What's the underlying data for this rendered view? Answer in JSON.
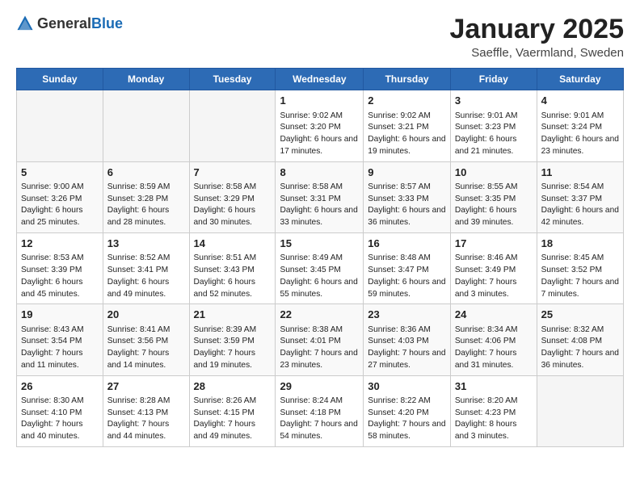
{
  "header": {
    "logo_general": "General",
    "logo_blue": "Blue",
    "title": "January 2025",
    "subtitle": "Saeffle, Vaermland, Sweden"
  },
  "weekdays": [
    "Sunday",
    "Monday",
    "Tuesday",
    "Wednesday",
    "Thursday",
    "Friday",
    "Saturday"
  ],
  "weeks": [
    [
      {
        "day": "",
        "info": ""
      },
      {
        "day": "",
        "info": ""
      },
      {
        "day": "",
        "info": ""
      },
      {
        "day": "1",
        "info": "Sunrise: 9:02 AM\nSunset: 3:20 PM\nDaylight: 6 hours\nand 17 minutes."
      },
      {
        "day": "2",
        "info": "Sunrise: 9:02 AM\nSunset: 3:21 PM\nDaylight: 6 hours\nand 19 minutes."
      },
      {
        "day": "3",
        "info": "Sunrise: 9:01 AM\nSunset: 3:23 PM\nDaylight: 6 hours\nand 21 minutes."
      },
      {
        "day": "4",
        "info": "Sunrise: 9:01 AM\nSunset: 3:24 PM\nDaylight: 6 hours\nand 23 minutes."
      }
    ],
    [
      {
        "day": "5",
        "info": "Sunrise: 9:00 AM\nSunset: 3:26 PM\nDaylight: 6 hours\nand 25 minutes."
      },
      {
        "day": "6",
        "info": "Sunrise: 8:59 AM\nSunset: 3:28 PM\nDaylight: 6 hours\nand 28 minutes."
      },
      {
        "day": "7",
        "info": "Sunrise: 8:58 AM\nSunset: 3:29 PM\nDaylight: 6 hours\nand 30 minutes."
      },
      {
        "day": "8",
        "info": "Sunrise: 8:58 AM\nSunset: 3:31 PM\nDaylight: 6 hours\nand 33 minutes."
      },
      {
        "day": "9",
        "info": "Sunrise: 8:57 AM\nSunset: 3:33 PM\nDaylight: 6 hours\nand 36 minutes."
      },
      {
        "day": "10",
        "info": "Sunrise: 8:55 AM\nSunset: 3:35 PM\nDaylight: 6 hours\nand 39 minutes."
      },
      {
        "day": "11",
        "info": "Sunrise: 8:54 AM\nSunset: 3:37 PM\nDaylight: 6 hours\nand 42 minutes."
      }
    ],
    [
      {
        "day": "12",
        "info": "Sunrise: 8:53 AM\nSunset: 3:39 PM\nDaylight: 6 hours\nand 45 minutes."
      },
      {
        "day": "13",
        "info": "Sunrise: 8:52 AM\nSunset: 3:41 PM\nDaylight: 6 hours\nand 49 minutes."
      },
      {
        "day": "14",
        "info": "Sunrise: 8:51 AM\nSunset: 3:43 PM\nDaylight: 6 hours\nand 52 minutes."
      },
      {
        "day": "15",
        "info": "Sunrise: 8:49 AM\nSunset: 3:45 PM\nDaylight: 6 hours\nand 55 minutes."
      },
      {
        "day": "16",
        "info": "Sunrise: 8:48 AM\nSunset: 3:47 PM\nDaylight: 6 hours\nand 59 minutes."
      },
      {
        "day": "17",
        "info": "Sunrise: 8:46 AM\nSunset: 3:49 PM\nDaylight: 7 hours\nand 3 minutes."
      },
      {
        "day": "18",
        "info": "Sunrise: 8:45 AM\nSunset: 3:52 PM\nDaylight: 7 hours\nand 7 minutes."
      }
    ],
    [
      {
        "day": "19",
        "info": "Sunrise: 8:43 AM\nSunset: 3:54 PM\nDaylight: 7 hours\nand 11 minutes."
      },
      {
        "day": "20",
        "info": "Sunrise: 8:41 AM\nSunset: 3:56 PM\nDaylight: 7 hours\nand 14 minutes."
      },
      {
        "day": "21",
        "info": "Sunrise: 8:39 AM\nSunset: 3:59 PM\nDaylight: 7 hours\nand 19 minutes."
      },
      {
        "day": "22",
        "info": "Sunrise: 8:38 AM\nSunset: 4:01 PM\nDaylight: 7 hours\nand 23 minutes."
      },
      {
        "day": "23",
        "info": "Sunrise: 8:36 AM\nSunset: 4:03 PM\nDaylight: 7 hours\nand 27 minutes."
      },
      {
        "day": "24",
        "info": "Sunrise: 8:34 AM\nSunset: 4:06 PM\nDaylight: 7 hours\nand 31 minutes."
      },
      {
        "day": "25",
        "info": "Sunrise: 8:32 AM\nSunset: 4:08 PM\nDaylight: 7 hours\nand 36 minutes."
      }
    ],
    [
      {
        "day": "26",
        "info": "Sunrise: 8:30 AM\nSunset: 4:10 PM\nDaylight: 7 hours\nand 40 minutes."
      },
      {
        "day": "27",
        "info": "Sunrise: 8:28 AM\nSunset: 4:13 PM\nDaylight: 7 hours\nand 44 minutes."
      },
      {
        "day": "28",
        "info": "Sunrise: 8:26 AM\nSunset: 4:15 PM\nDaylight: 7 hours\nand 49 minutes."
      },
      {
        "day": "29",
        "info": "Sunrise: 8:24 AM\nSunset: 4:18 PM\nDaylight: 7 hours\nand 54 minutes."
      },
      {
        "day": "30",
        "info": "Sunrise: 8:22 AM\nSunset: 4:20 PM\nDaylight: 7 hours\nand 58 minutes."
      },
      {
        "day": "31",
        "info": "Sunrise: 8:20 AM\nSunset: 4:23 PM\nDaylight: 8 hours\nand 3 minutes."
      },
      {
        "day": "",
        "info": ""
      }
    ]
  ]
}
